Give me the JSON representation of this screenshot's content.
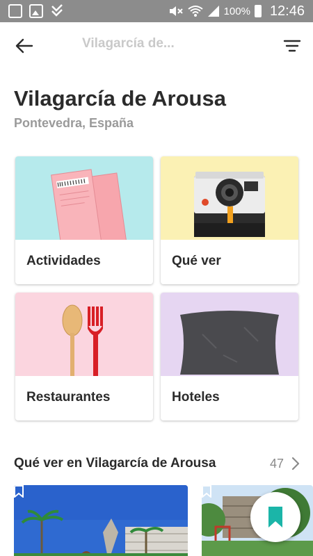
{
  "status_bar": {
    "battery": "100%",
    "time": "12:46",
    "icons": [
      "whatsapp-icon",
      "gallery-icon",
      "check-icon",
      "mute-icon",
      "wifi-icon",
      "signal-icon",
      "battery-icon"
    ]
  },
  "toolbar": {
    "title": "Vilagarcía de...",
    "back_icon": "arrow-left-icon",
    "filter_icon": "filter-icon"
  },
  "header": {
    "title": "Vilagarcía de Arousa",
    "subtitle": "Pontevedra, España"
  },
  "categories": [
    {
      "label": "Actividades",
      "image": "tickets",
      "bg": "#b6eaec"
    },
    {
      "label": "Qué ver",
      "image": "camera",
      "bg": "#fbf1b4"
    },
    {
      "label": "Restaurantes",
      "image": "spoon-fork",
      "bg": "#fbd5df"
    },
    {
      "label": "Hoteles",
      "image": "pillow",
      "bg": "#e6d6f2"
    }
  ],
  "section": {
    "title": "Qué ver en Vilagarcía de Arousa",
    "count": "47"
  },
  "colors": {
    "accent": "#1bb5a8",
    "status_bar": "#8c8c8c",
    "text_primary": "#2b2b2b",
    "text_secondary": "#9a9a9a"
  }
}
